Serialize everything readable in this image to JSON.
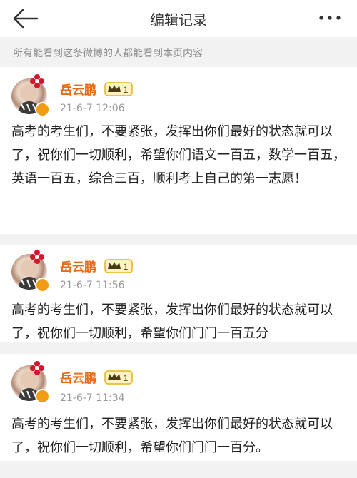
{
  "header": {
    "title": "编辑记录",
    "back_icon": "arrow-left-icon",
    "more_icon": "more-dots-icon"
  },
  "notice": "所有能看到这条微博的人都能看到本页内容",
  "colors": {
    "username": "#e86b15",
    "background": "#f2f2f2",
    "card": "#ffffff",
    "meta_text": "#999999"
  },
  "records": [
    {
      "username": "岳云鹏",
      "level": "1",
      "time": "21-6-7 12:06",
      "content": "高考的考生们，不要紧张，发挥出你们最好的状态就可以了，祝你们一切顺利，希望你们语文一百五，数学一百五，英语一百五，综合三百，顺利考上自己的第一志愿！"
    },
    {
      "username": "岳云鹏",
      "level": "1",
      "time": "21-6-7 11:56",
      "content": "高考的考生们，不要紧张，发挥出你们最好的状态就可以了，祝你们一切顺利，希望你们门门一百五分"
    },
    {
      "username": "岳云鹏",
      "level": "1",
      "time": "21-6-7 11:34",
      "content": "高考的考生们，不要紧张，发挥出你们最好的状态就可以了，祝你们一切顺利，希望你们门门一百分。"
    }
  ]
}
